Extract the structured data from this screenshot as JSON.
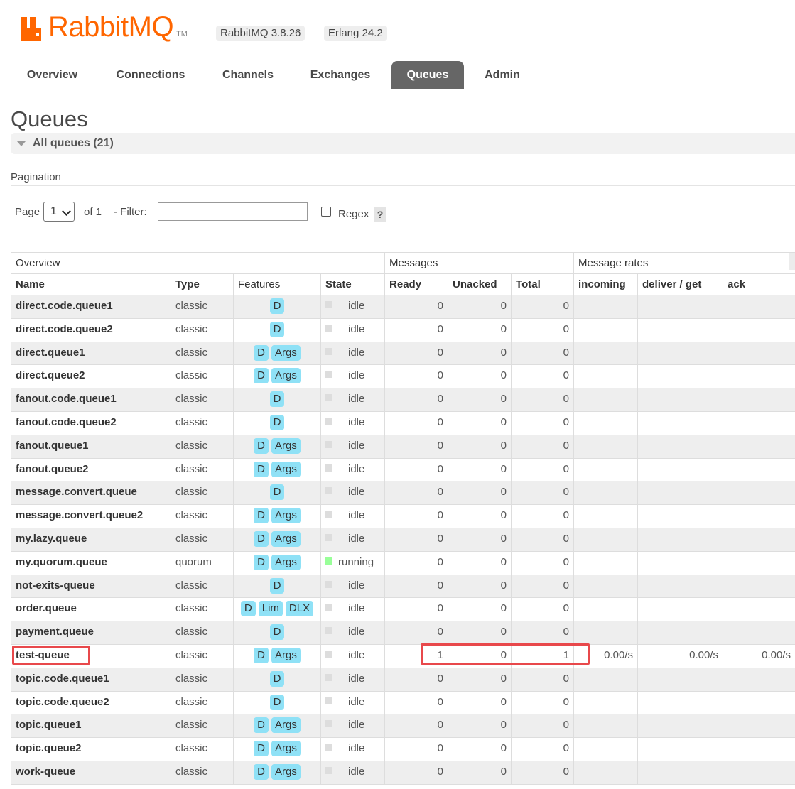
{
  "header": {
    "logo_text": "RabbitMQ",
    "logo_tm": "TM",
    "version": "RabbitMQ 3.8.26",
    "erlang": "Erlang 24.2",
    "brand_color": "#ff6600"
  },
  "tabs": [
    {
      "label": "Overview",
      "active": false
    },
    {
      "label": "Connections",
      "active": false
    },
    {
      "label": "Channels",
      "active": false
    },
    {
      "label": "Exchanges",
      "active": false
    },
    {
      "label": "Queues",
      "active": true
    },
    {
      "label": "Admin",
      "active": false
    }
  ],
  "page": {
    "title": "Queues",
    "section_label": "All queues (21)",
    "pagination_label": "Pagination"
  },
  "pager": {
    "page_label": "Page",
    "page_value": "1",
    "of_label": "of 1",
    "filter_label": "- Filter:",
    "filter_value": "",
    "regex_label": "Regex",
    "regex_checked": false,
    "help": "?"
  },
  "table": {
    "groups": {
      "overview": "Overview",
      "messages": "Messages",
      "rates": "Message rates"
    },
    "columns": {
      "name": "Name",
      "type": "Type",
      "features": "Features",
      "state": "State",
      "ready": "Ready",
      "unacked": "Unacked",
      "total": "Total",
      "incoming": "incoming",
      "deliver_get": "deliver / get",
      "ack": "ack"
    },
    "rows": [
      {
        "name": "direct.code.queue1",
        "type": "classic",
        "features": [
          "D"
        ],
        "state": "idle",
        "ready": "0",
        "unacked": "0",
        "total": "0",
        "incoming": "",
        "deliver_get": "",
        "ack": ""
      },
      {
        "name": "direct.code.queue2",
        "type": "classic",
        "features": [
          "D"
        ],
        "state": "idle",
        "ready": "0",
        "unacked": "0",
        "total": "0",
        "incoming": "",
        "deliver_get": "",
        "ack": ""
      },
      {
        "name": "direct.queue1",
        "type": "classic",
        "features": [
          "D",
          "Args"
        ],
        "state": "idle",
        "ready": "0",
        "unacked": "0",
        "total": "0",
        "incoming": "",
        "deliver_get": "",
        "ack": ""
      },
      {
        "name": "direct.queue2",
        "type": "classic",
        "features": [
          "D",
          "Args"
        ],
        "state": "idle",
        "ready": "0",
        "unacked": "0",
        "total": "0",
        "incoming": "",
        "deliver_get": "",
        "ack": ""
      },
      {
        "name": "fanout.code.queue1",
        "type": "classic",
        "features": [
          "D"
        ],
        "state": "idle",
        "ready": "0",
        "unacked": "0",
        "total": "0",
        "incoming": "",
        "deliver_get": "",
        "ack": ""
      },
      {
        "name": "fanout.code.queue2",
        "type": "classic",
        "features": [
          "D"
        ],
        "state": "idle",
        "ready": "0",
        "unacked": "0",
        "total": "0",
        "incoming": "",
        "deliver_get": "",
        "ack": ""
      },
      {
        "name": "fanout.queue1",
        "type": "classic",
        "features": [
          "D",
          "Args"
        ],
        "state": "idle",
        "ready": "0",
        "unacked": "0",
        "total": "0",
        "incoming": "",
        "deliver_get": "",
        "ack": ""
      },
      {
        "name": "fanout.queue2",
        "type": "classic",
        "features": [
          "D",
          "Args"
        ],
        "state": "idle",
        "ready": "0",
        "unacked": "0",
        "total": "0",
        "incoming": "",
        "deliver_get": "",
        "ack": ""
      },
      {
        "name": "message.convert.queue",
        "type": "classic",
        "features": [
          "D"
        ],
        "state": "idle",
        "ready": "0",
        "unacked": "0",
        "total": "0",
        "incoming": "",
        "deliver_get": "",
        "ack": ""
      },
      {
        "name": "message.convert.queue2",
        "type": "classic",
        "features": [
          "D",
          "Args"
        ],
        "state": "idle",
        "ready": "0",
        "unacked": "0",
        "total": "0",
        "incoming": "",
        "deliver_get": "",
        "ack": ""
      },
      {
        "name": "my.lazy.queue",
        "type": "classic",
        "features": [
          "D",
          "Args"
        ],
        "state": "idle",
        "ready": "0",
        "unacked": "0",
        "total": "0",
        "incoming": "",
        "deliver_get": "",
        "ack": ""
      },
      {
        "name": "my.quorum.queue",
        "type": "quorum",
        "features": [
          "D",
          "Args"
        ],
        "state": "running",
        "ready": "0",
        "unacked": "0",
        "total": "0",
        "incoming": "",
        "deliver_get": "",
        "ack": ""
      },
      {
        "name": "not-exits-queue",
        "type": "classic",
        "features": [
          "D"
        ],
        "state": "idle",
        "ready": "0",
        "unacked": "0",
        "total": "0",
        "incoming": "",
        "deliver_get": "",
        "ack": ""
      },
      {
        "name": "order.queue",
        "type": "classic",
        "features": [
          "D",
          "Lim",
          "DLX"
        ],
        "state": "idle",
        "ready": "0",
        "unacked": "0",
        "total": "0",
        "incoming": "",
        "deliver_get": "",
        "ack": ""
      },
      {
        "name": "payment.queue",
        "type": "classic",
        "features": [
          "D"
        ],
        "state": "idle",
        "ready": "0",
        "unacked": "0",
        "total": "0",
        "incoming": "",
        "deliver_get": "",
        "ack": ""
      },
      {
        "name": "test-queue",
        "type": "classic",
        "features": [
          "D",
          "Args"
        ],
        "state": "idle",
        "ready": "1",
        "unacked": "0",
        "total": "1",
        "incoming": "0.00/s",
        "deliver_get": "0.00/s",
        "ack": "0.00/s"
      },
      {
        "name": "topic.code.queue1",
        "type": "classic",
        "features": [
          "D"
        ],
        "state": "idle",
        "ready": "0",
        "unacked": "0",
        "total": "0",
        "incoming": "",
        "deliver_get": "",
        "ack": ""
      },
      {
        "name": "topic.code.queue2",
        "type": "classic",
        "features": [
          "D"
        ],
        "state": "idle",
        "ready": "0",
        "unacked": "0",
        "total": "0",
        "incoming": "",
        "deliver_get": "",
        "ack": ""
      },
      {
        "name": "topic.queue1",
        "type": "classic",
        "features": [
          "D",
          "Args"
        ],
        "state": "idle",
        "ready": "0",
        "unacked": "0",
        "total": "0",
        "incoming": "",
        "deliver_get": "",
        "ack": ""
      },
      {
        "name": "topic.queue2",
        "type": "classic",
        "features": [
          "D",
          "Args"
        ],
        "state": "idle",
        "ready": "0",
        "unacked": "0",
        "total": "0",
        "incoming": "",
        "deliver_get": "",
        "ack": ""
      },
      {
        "name": "work-queue",
        "type": "classic",
        "features": [
          "D",
          "Args"
        ],
        "state": "idle",
        "ready": "0",
        "unacked": "0",
        "total": "0",
        "incoming": "",
        "deliver_get": "",
        "ack": ""
      }
    ]
  },
  "colors": {
    "badge": "#8fe1f6",
    "active_tab": "#666666",
    "running": "#99ff99",
    "highlight": "#e8484b"
  }
}
